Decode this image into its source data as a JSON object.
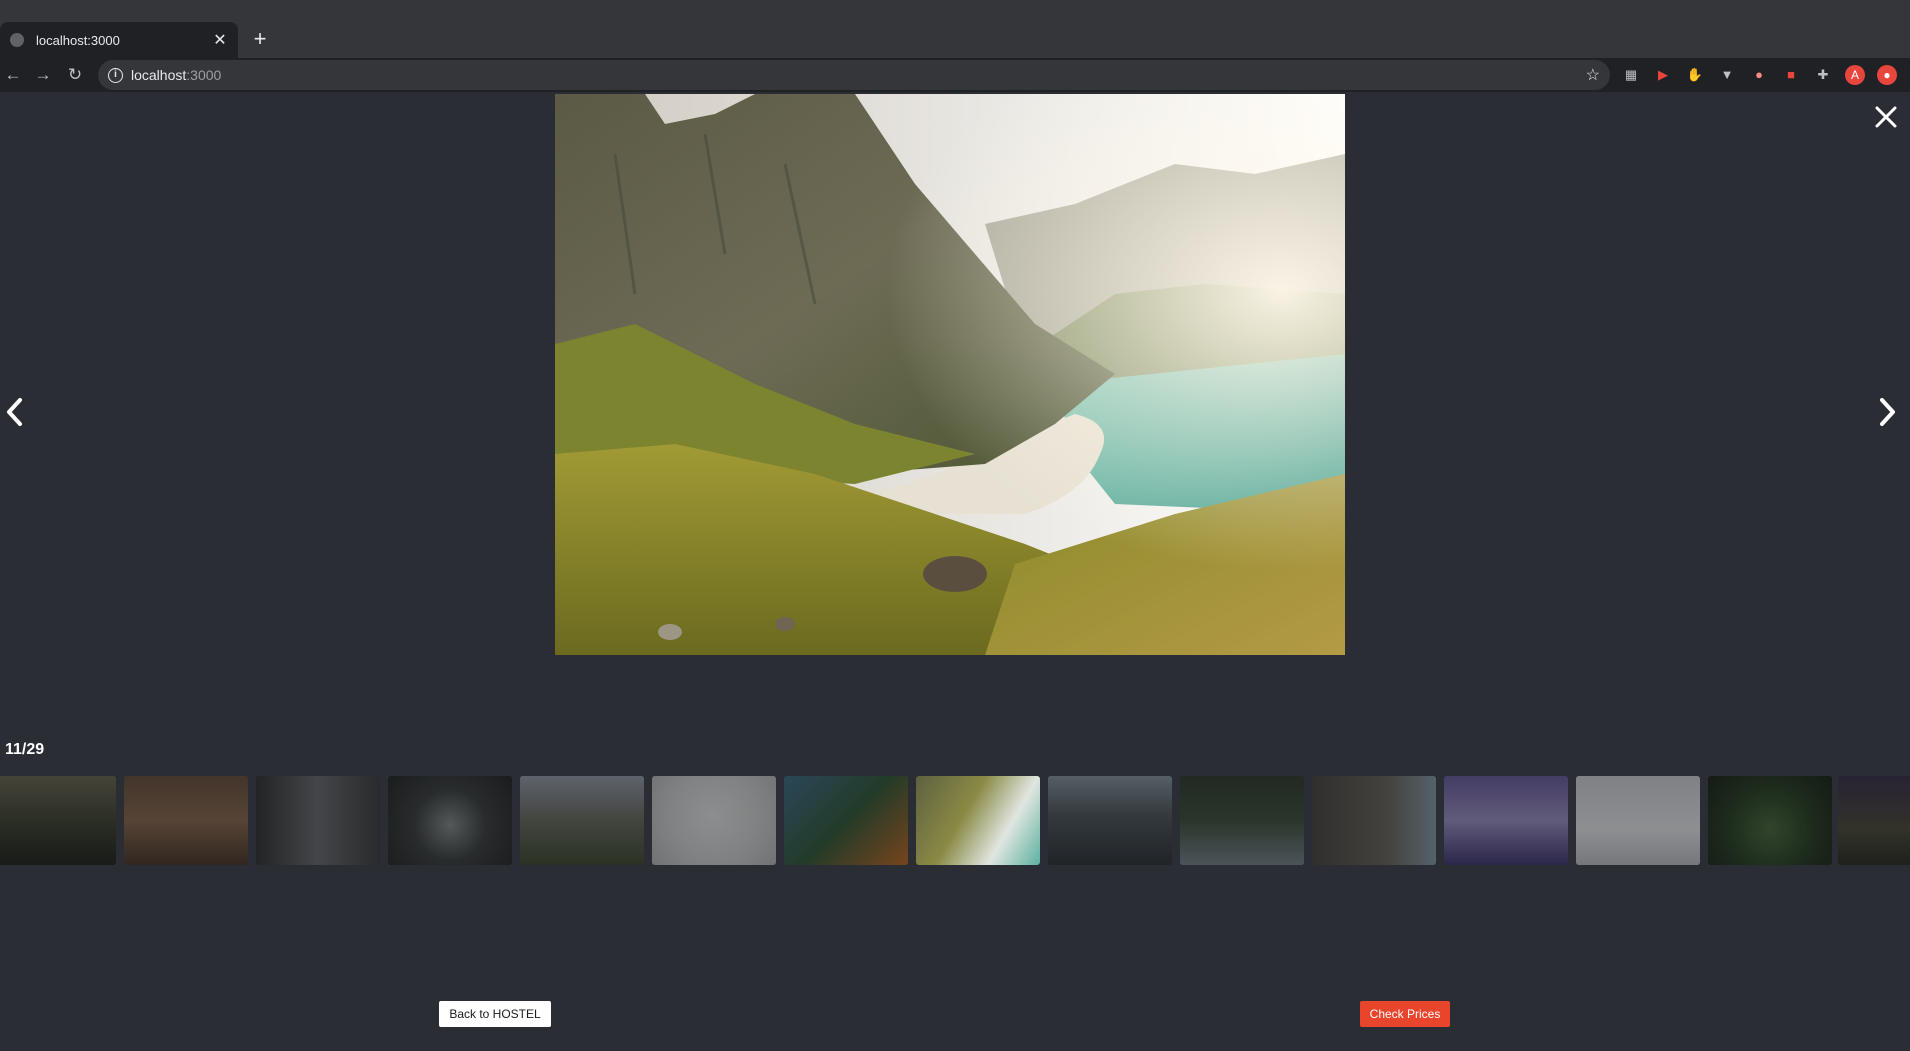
{
  "browser": {
    "tab_title": "localhost:3000",
    "tab_close": "✕",
    "new_tab": "+",
    "url_host": "localhost",
    "url_port": ":3000",
    "profile_initial": "A"
  },
  "gallery": {
    "counter": "11/29",
    "back_label": "Back to HOSTEL",
    "prices_label": "Check Prices",
    "accent_color": "#e8452c",
    "main_photo": "mountain-valley-beach",
    "thumbnails": [
      "forest-sunset",
      "wall-of-pictures",
      "misty-cliffs",
      "rock-arch",
      "mountain-lake",
      "coin-telescope",
      "orange-tree",
      "mountain-valley-beach",
      "mountain-road",
      "forest-bridge",
      "narrow-alley",
      "purple-lake",
      "snowy-path",
      "green-tunnel",
      "forest-path"
    ],
    "active_index": 7
  }
}
